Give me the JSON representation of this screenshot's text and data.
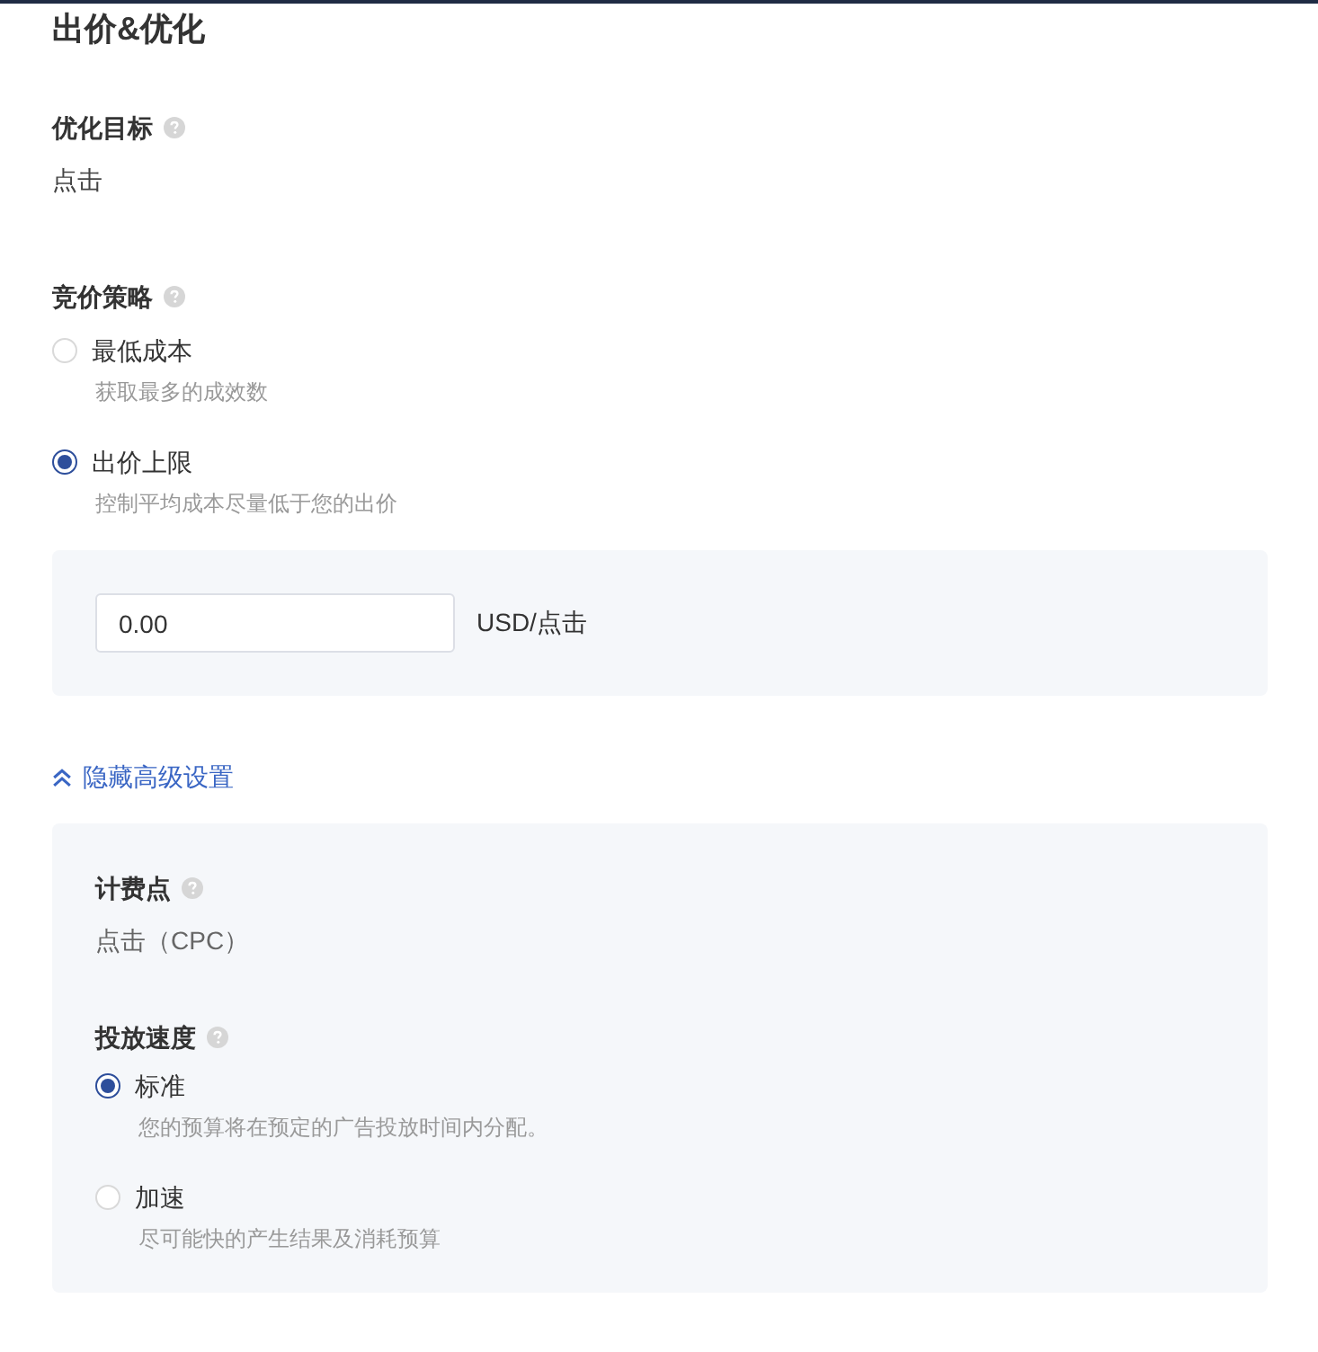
{
  "title": "出价&优化",
  "goal": {
    "label": "优化目标",
    "value": "点击"
  },
  "strategy": {
    "label": "竞价策略",
    "options": [
      {
        "label": "最低成本",
        "description": "获取最多的成效数",
        "selected": false
      },
      {
        "label": "出价上限",
        "description": "控制平均成本尽量低于您的出价",
        "selected": true
      }
    ],
    "bid": {
      "value": "0.00",
      "unit": "USD/点击"
    }
  },
  "advanced_toggle": {
    "label": "隐藏高级设置",
    "expanded": true
  },
  "advanced": {
    "billing": {
      "label": "计费点",
      "value": "点击（CPC）"
    },
    "pacing": {
      "label": "投放速度",
      "options": [
        {
          "label": "标准",
          "description": "您的预算将在预定的广告投放时间内分配。",
          "selected": true
        },
        {
          "label": "加速",
          "description": "尽可能快的产生结果及消耗预算",
          "selected": false
        }
      ]
    }
  }
}
